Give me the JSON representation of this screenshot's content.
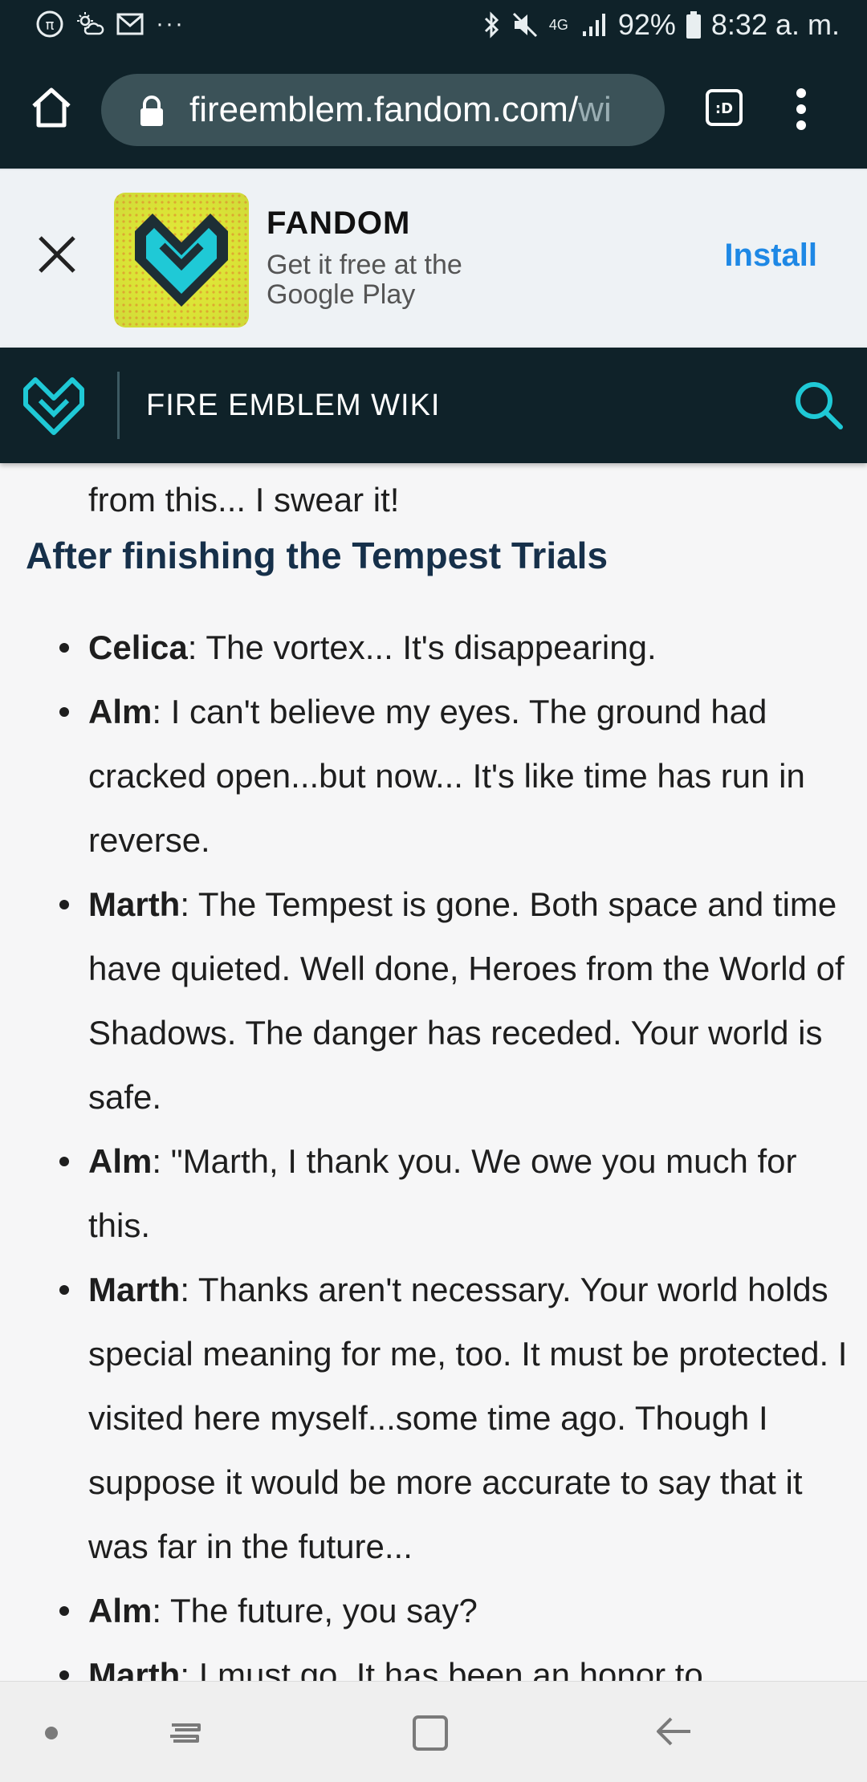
{
  "status_bar": {
    "battery": "92%",
    "time": "8:32 a. m.",
    "network": "4G",
    "left_icons": [
      "pi-icon",
      "weather-icon",
      "gmail-icon",
      "more-dots-icon"
    ],
    "right_icons": [
      "bluetooth-icon",
      "mute-icon",
      "signal-icon",
      "battery-icon"
    ]
  },
  "browser": {
    "url_main": "fireemblem.fandom.com/",
    "url_fade": "wi",
    "tab_badge": ":D"
  },
  "app_banner": {
    "app_name": "FANDOM",
    "subtitle": "Get it free at the Google Play",
    "install_label": "Install",
    "accent_color": "#1e88e5"
  },
  "wiki_nav": {
    "title": "FIRE EMBLEM WIKI",
    "brand_color": "#1fc9d6"
  },
  "article": {
    "previous_line": "from this... I swear it!",
    "section_heading": "After finishing the Tempest Trials",
    "dialogue": [
      {
        "speaker": "Celica",
        "text": ": The vortex... It's disappearing."
      },
      {
        "speaker": "Alm",
        "text": ": I can't believe my eyes. The ground had cracked open...but now... It's like time has run in reverse."
      },
      {
        "speaker": "Marth",
        "text": ": The Tempest is gone. Both space and time have quieted. Well done, Heroes from the World of Shadows. The danger has receded. Your world is safe."
      },
      {
        "speaker": "Alm",
        "text": ": \"Marth, I thank you. We owe you much for this."
      },
      {
        "speaker": "Marth",
        "text": ": Thanks aren't necessary. Your world holds special meaning for me, too. It must be protected. I visited here myself...some time ago. Though I suppose it would be more accurate to say that it was far in the future..."
      },
      {
        "speaker": "Alm",
        "text": ": The future, you say?"
      },
      {
        "speaker": "Marth",
        "text": ": I must go. It has been an honor to"
      }
    ]
  }
}
